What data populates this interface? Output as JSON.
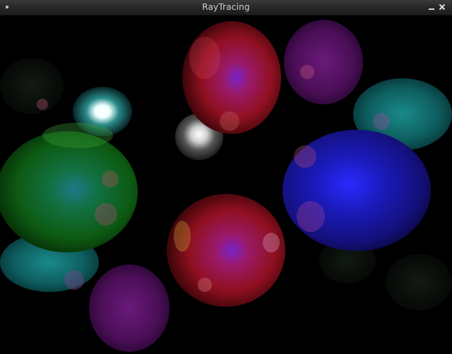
{
  "window": {
    "title": "RayTracing",
    "menu_icon": "window-menu-icon",
    "minimize_icon": "minimize-icon",
    "close_icon": "close-icon"
  },
  "scene": {
    "background": "#000000",
    "sphere_colors": {
      "red": "#b01020",
      "green": "#1a7a1a",
      "blue": "#2020d0",
      "cyan": "#1c9a9a",
      "purple": "#8a2090",
      "chrome": "#dddddd"
    }
  }
}
